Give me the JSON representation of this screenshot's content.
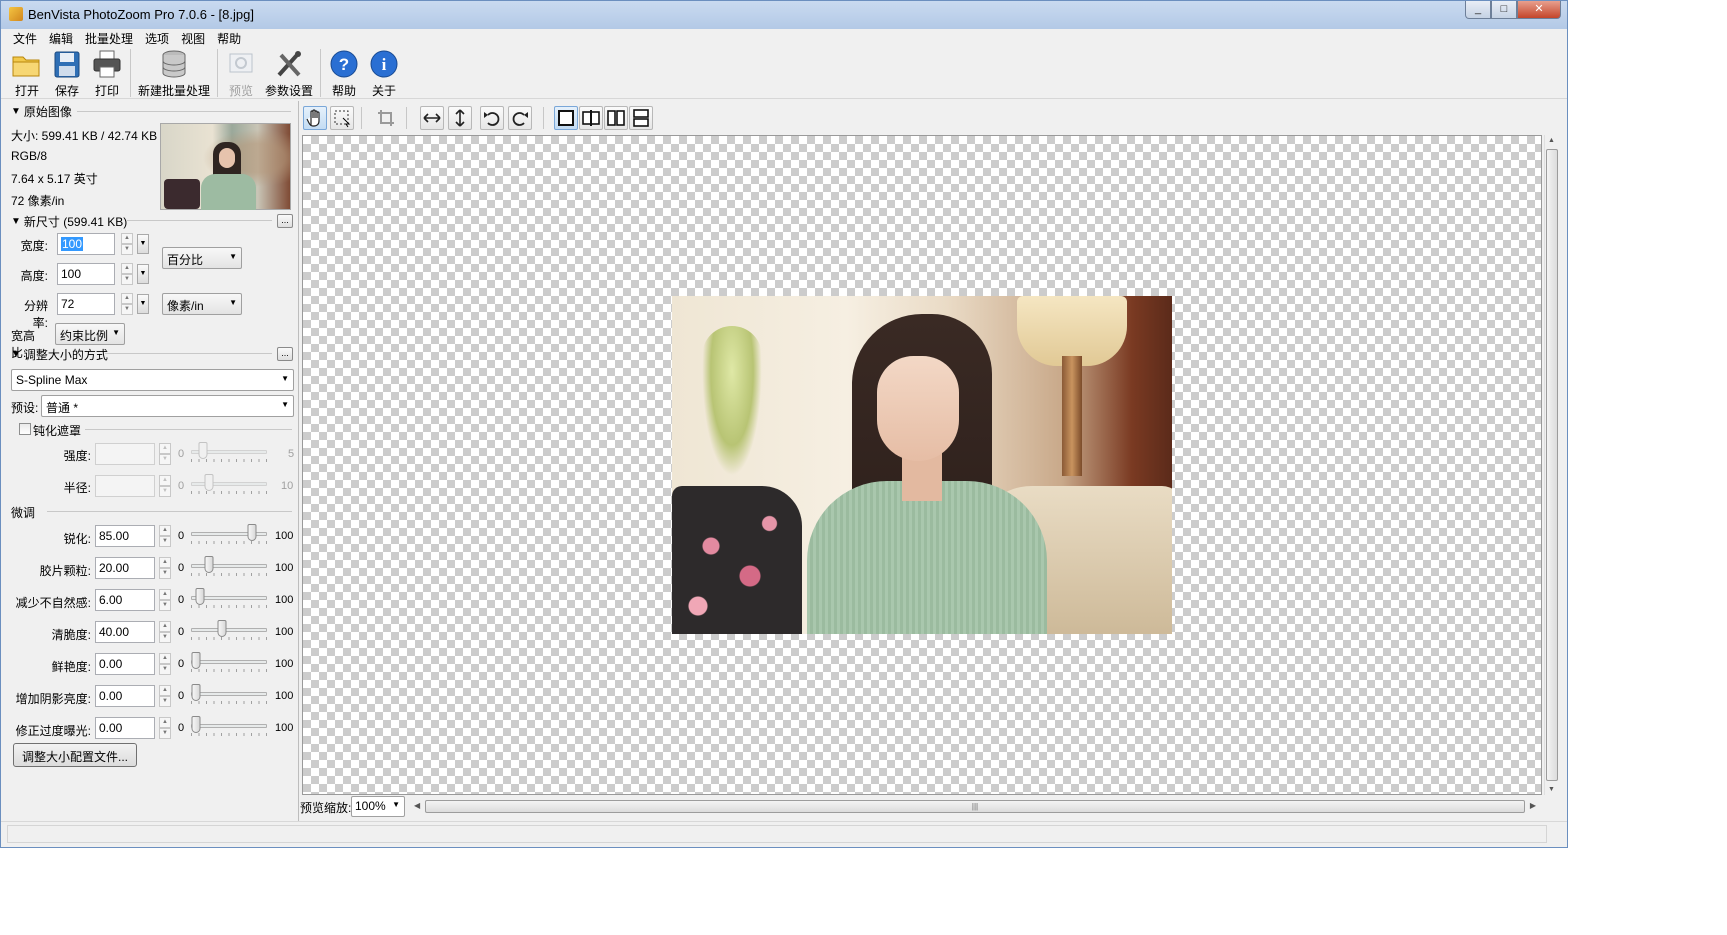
{
  "window": {
    "title": "BenVista PhotoZoom Pro 7.0.6 - [8.jpg]"
  },
  "menu": [
    "文件",
    "编辑",
    "批量处理",
    "选项",
    "视图",
    "帮助"
  ],
  "toolbar": {
    "open": "打开",
    "save": "保存",
    "print": "打印",
    "batch": "新建批量处理",
    "preview": "预览",
    "settings": "参数设置",
    "help": "帮助",
    "about": "关于"
  },
  "original": {
    "heading": "原始图像",
    "size": "大小: 599.41 KB / 42.74 KB",
    "mode": "RGB/8",
    "dimensions": "7.64 x 5.17 英寸",
    "resolution": "72 像素/in"
  },
  "new_size": {
    "heading": "新尺寸 (599.41 KB)",
    "width_label": "宽度:",
    "width_value": "100",
    "height_label": "高度:",
    "height_value": "100",
    "resolution_label": "分辨率:",
    "resolution_value": "72",
    "unit_size": "百分比",
    "unit_resolution": "像素/in",
    "aspect_label": "宽高比:",
    "aspect_value": "约束比例"
  },
  "resize_method": {
    "heading": "调整大小的方式",
    "method": "S-Spline Max",
    "preset_label": "预设:",
    "preset_value": "普通 *"
  },
  "unsharp": {
    "heading": "钝化遮罩",
    "checked": false,
    "strength_label": "强度:",
    "strength_min": "0",
    "strength_max": "5",
    "strength_level": 0.1,
    "radius_label": "半径:",
    "radius_min": "0",
    "radius_max": "10",
    "radius_level": 0.2
  },
  "fine_tune": {
    "heading": "微调",
    "rows": [
      {
        "label": "锐化:",
        "value": "85.00",
        "min": "0",
        "max": "100",
        "level": 0.85
      },
      {
        "label": "胶片颗粒:",
        "value": "20.00",
        "min": "0",
        "max": "100",
        "level": 0.2
      },
      {
        "label": "减少不自然感:",
        "value": "6.00",
        "min": "0",
        "max": "100",
        "level": 0.06
      },
      {
        "label": "清脆度:",
        "value": "40.00",
        "min": "0",
        "max": "100",
        "level": 0.4
      },
      {
        "label": "鲜艳度:",
        "value": "0.00",
        "min": "0",
        "max": "100",
        "level": 0.0
      },
      {
        "label": "增加阴影亮度:",
        "value": "0.00",
        "min": "0",
        "max": "100",
        "level": 0.0
      },
      {
        "label": "修正过度曝光:",
        "value": "0.00",
        "min": "0",
        "max": "100",
        "level": 0.0
      }
    ],
    "profiles_button": "调整大小配置文件..."
  },
  "preview": {
    "zoom_label": "预览缩放:",
    "zoom_value": "100%"
  }
}
